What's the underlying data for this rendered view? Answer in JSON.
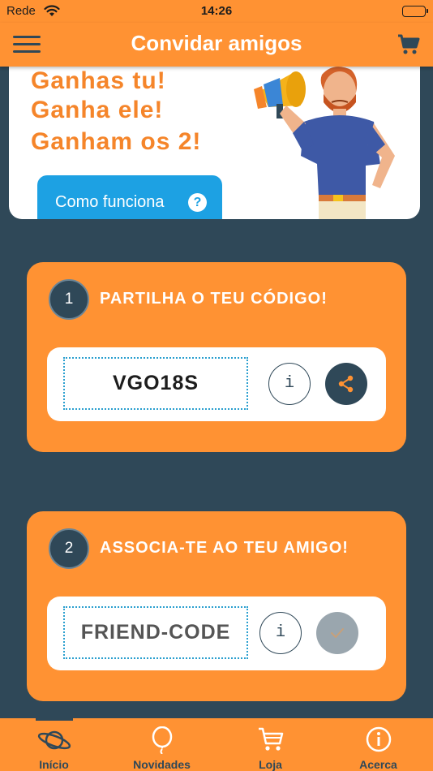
{
  "status_bar": {
    "carrier": "Rede",
    "time": "14:26",
    "battery_level": 1.0
  },
  "nav": {
    "title": "Convidar amigos",
    "menu_icon": "hamburger-menu-icon",
    "cart_icon": "shopping-cart-icon"
  },
  "hero": {
    "lines": [
      "Ganhas tu!",
      "Ganha ele!",
      "Ganham os 2!"
    ],
    "how_button_label": "Como funciona",
    "help_icon_glyph": "?",
    "illustration": "man-with-megaphone"
  },
  "steps": [
    {
      "number": "1",
      "title": "PARTILHA O TEU CÓDIGO!",
      "code": "VGO18S",
      "info_glyph": "i",
      "action_icon": "share-icon"
    },
    {
      "number": "2",
      "title": "ASSOCIA-TE AO TEU AMIGO!",
      "placeholder": "FRIEND-CODE",
      "info_glyph": "i",
      "action_icon": "check-icon"
    }
  ],
  "tabs": [
    {
      "label": "Início",
      "icon": "planet-icon",
      "active": true
    },
    {
      "label": "Novidades",
      "icon": "balloon-icon",
      "active": false
    },
    {
      "label": "Loja",
      "icon": "cart-icon",
      "active": false
    },
    {
      "label": "Acerca",
      "icon": "info-circle-icon",
      "active": false
    }
  ],
  "colors": {
    "brand_orange": "#ff9233",
    "dark_navy": "#2f4858",
    "hero_text": "#f5852a",
    "button_blue": "#1da1e3",
    "disabled_gray": "#9aa6ae"
  }
}
